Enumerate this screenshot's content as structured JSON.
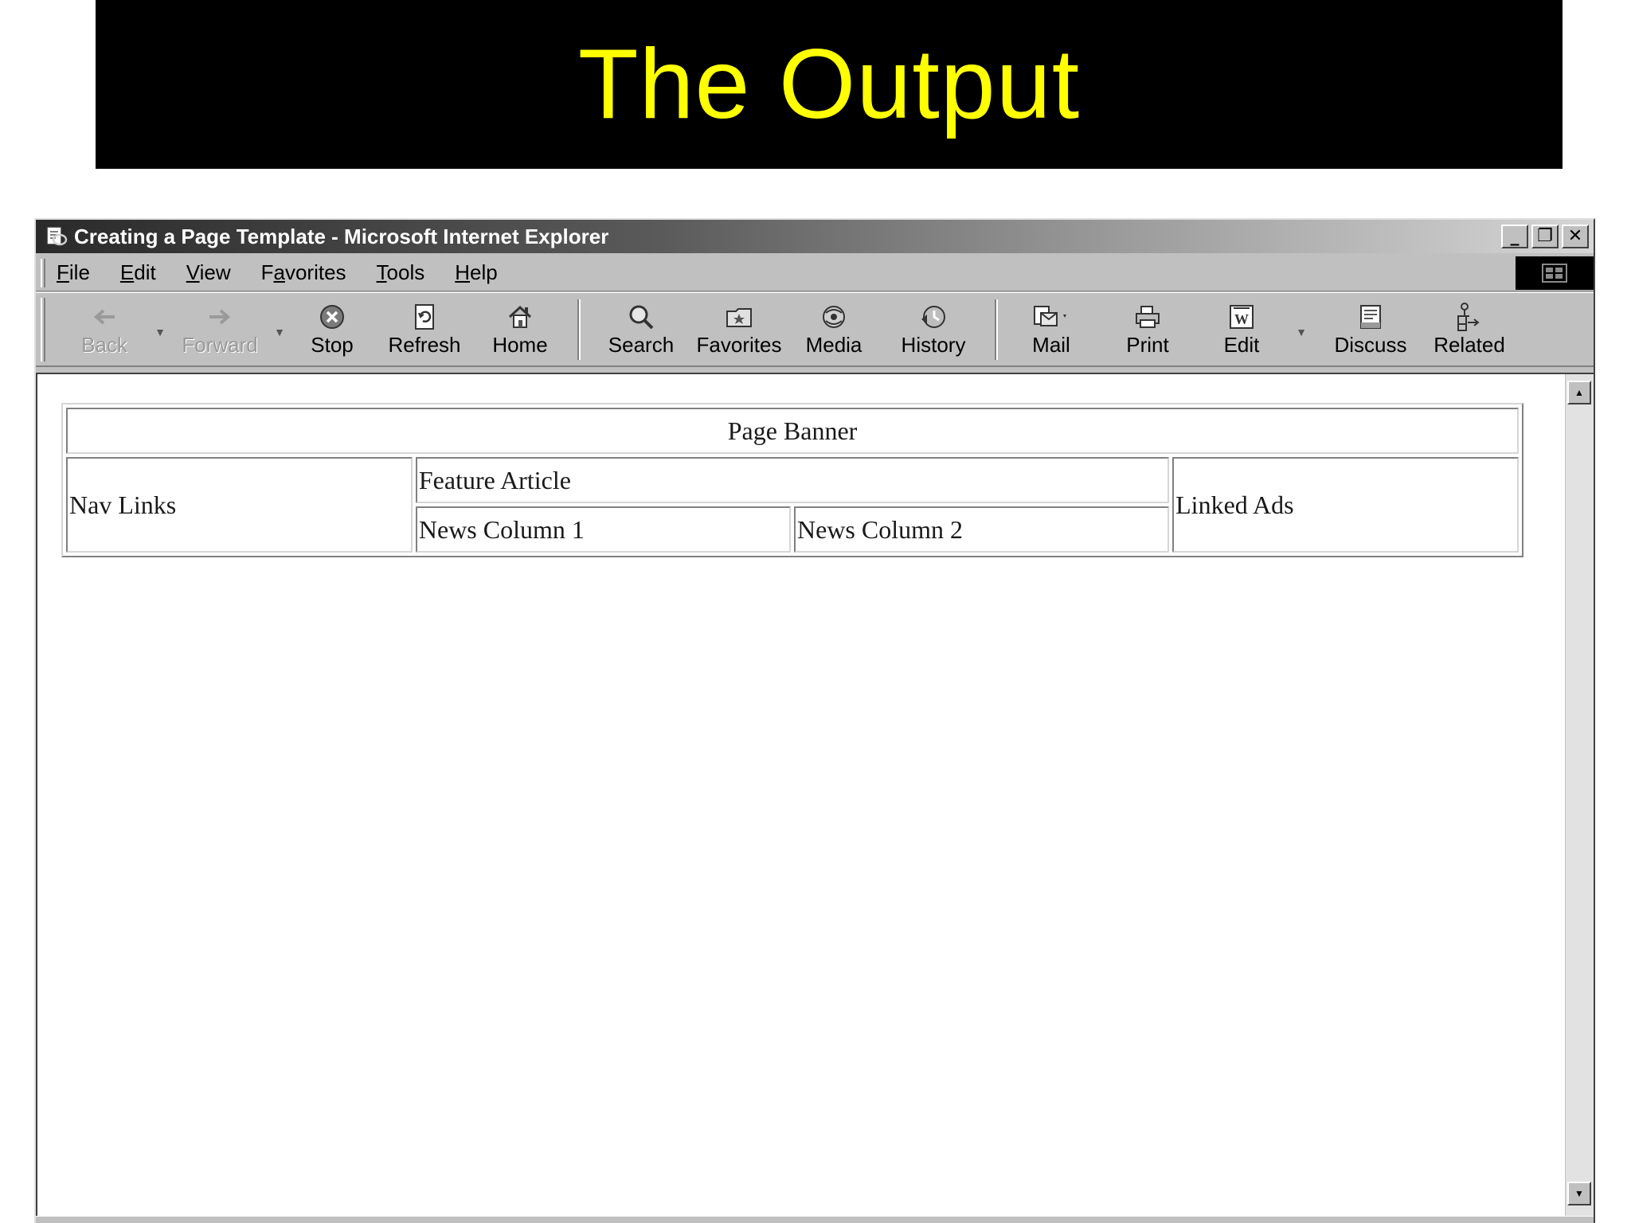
{
  "slide": {
    "title": "The Output"
  },
  "window": {
    "title": "Creating a Page Template - Microsoft Internet Explorer",
    "controls": {
      "minimize": "_",
      "restore": "❐",
      "close": "✕"
    }
  },
  "menu": {
    "items": [
      {
        "pre": "",
        "key": "F",
        "post": "ile"
      },
      {
        "pre": "",
        "key": "E",
        "post": "dit"
      },
      {
        "pre": "",
        "key": "V",
        "post": "iew"
      },
      {
        "pre": "F",
        "key": "a",
        "post": "vorites"
      },
      {
        "pre": "",
        "key": "T",
        "post": "ools"
      },
      {
        "pre": "",
        "key": "H",
        "post": "elp"
      }
    ]
  },
  "toolbar": {
    "back": "Back",
    "forward": "Forward",
    "stop": "Stop",
    "refresh": "Refresh",
    "home": "Home",
    "search": "Search",
    "favorites": "Favorites",
    "media": "Media",
    "history": "History",
    "mail": "Mail",
    "print": "Print",
    "edit": "Edit",
    "discuss": "Discuss",
    "related": "Related"
  },
  "page": {
    "banner": "Page Banner",
    "nav_links": "Nav Links",
    "feature_article": "Feature Article",
    "news_column_1": "News Column 1",
    "news_column_2": "News Column 2",
    "linked_ads": "Linked Ads"
  },
  "icons": {
    "app": "ie-page-icon",
    "back": "arrow-left-icon",
    "forward": "arrow-right-icon",
    "stop": "stop-icon",
    "refresh": "refresh-icon",
    "home": "home-icon",
    "search": "search-icon",
    "favorites": "favorites-folder-icon",
    "media": "media-icon",
    "history": "history-icon",
    "mail": "mail-icon",
    "print": "printer-icon",
    "edit": "word-edit-icon",
    "discuss": "discuss-icon",
    "related": "related-icon"
  },
  "colors": {
    "slide_title_bg": "#000000",
    "slide_title_text": "#ffff00",
    "window_chrome": "#c0c0c0"
  }
}
